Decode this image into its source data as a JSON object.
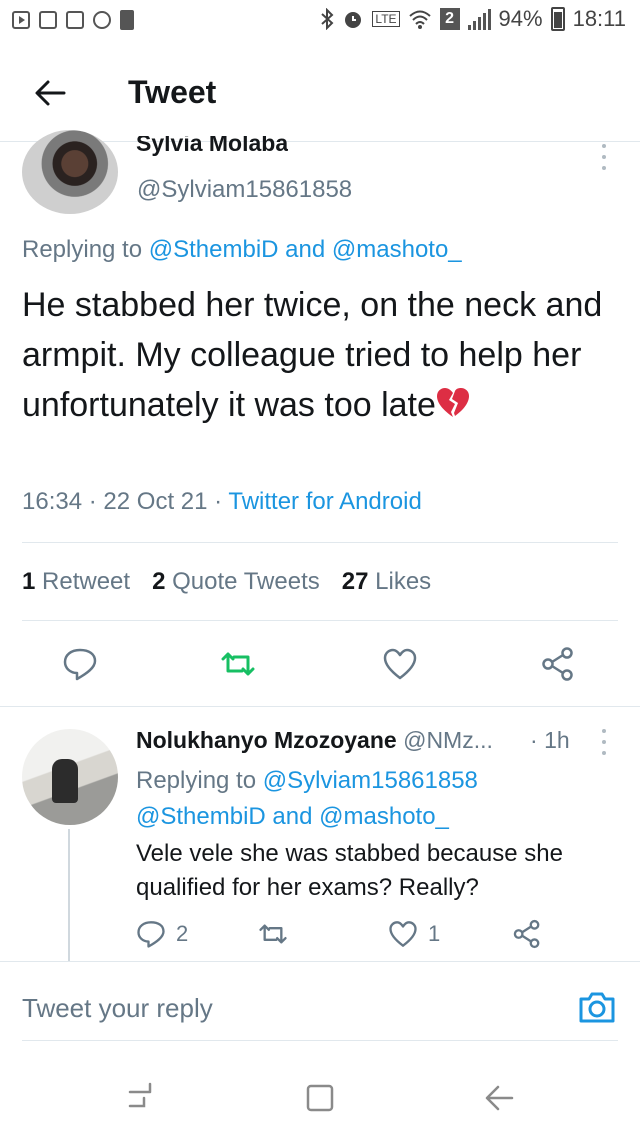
{
  "status_bar": {
    "battery": "94%",
    "time": "18:11",
    "network_label": "LTE",
    "sim_number": "2"
  },
  "header": {
    "title": "Tweet"
  },
  "main_tweet": {
    "author_name": "Sylvia Molaba",
    "author_handle": "@Sylviam15861858",
    "replying_prefix": "Replying to",
    "replying_user_1": "@SthembiD",
    "replying_and": "and",
    "replying_user_2": "@mashoto_",
    "text": "He stabbed her twice, on the neck and armpit. My colleague tried to help her unfortunately it was too late",
    "time": "16:34",
    "date": "22 Oct 21",
    "source": "Twitter for Android",
    "retweet_count": "1",
    "retweet_label": "Retweet",
    "quote_count": "2",
    "quote_label": "Quote Tweets",
    "like_count": "27",
    "like_label": "Likes"
  },
  "reply_tweet": {
    "author_name": "Nolukhanyo Mzozoyane",
    "author_handle": "@NMz...",
    "time": "1h",
    "replying_prefix": "Replying to",
    "replying_user_1": "@Sylviam15861858",
    "replying_user_2": "@SthembiD",
    "replying_and": "and",
    "replying_user_3": "@mashoto_",
    "text": "Vele vele she was stabbed because she qualified for her exams? Really?",
    "reply_count": "2",
    "like_count": "1"
  },
  "compose": {
    "placeholder": "Tweet your reply"
  },
  "colors": {
    "link": "#1b95e0",
    "muted": "#657786",
    "text": "#14171a",
    "retweet_green": "#17bf63",
    "divider": "#e1e8ed"
  }
}
